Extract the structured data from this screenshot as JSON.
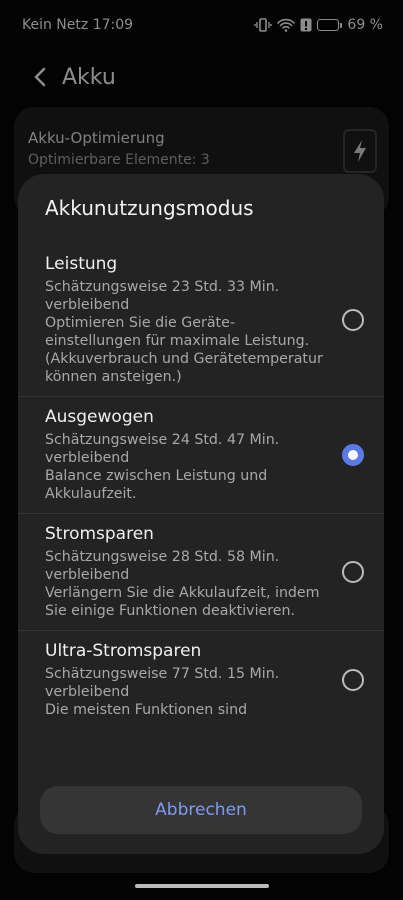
{
  "status_bar": {
    "carrier": "Kein Netz",
    "time": "17:09",
    "battery_percent": "69 %",
    "battery_level": 0.69
  },
  "app_bar": {
    "title": "Akku"
  },
  "background": {
    "card_title": "Akku-Optimierung",
    "card_subtitle": "Optimierbare Elemente: 3"
  },
  "dialog": {
    "title": "Akkunutzungsmodus",
    "options": [
      {
        "title": "Leistung",
        "estimate": "Schätzungsweise 23 Std. 33 Min. verbleibend",
        "description": "Optimieren Sie die Geräte-einstellungen für maximale Leistung. (Akkuverbrauch und Gerätetemperatur können ansteigen.)",
        "selected": false
      },
      {
        "title": "Ausgewogen",
        "estimate": "Schätzungsweise 24 Std. 47 Min. verbleibend",
        "description": "Balance zwischen Leistung und Akkulaufzeit.",
        "selected": true
      },
      {
        "title": "Stromsparen",
        "estimate": "Schätzungsweise 28 Std. 58 Min. verbleibend",
        "description": "Verlängern Sie die Akkulaufzeit, indem Sie einige Funktionen deaktivieren.",
        "selected": false
      },
      {
        "title": "Ultra-Stromsparen",
        "estimate": "Schätzungsweise 77 Std. 15 Min. verbleibend",
        "description": "Die meisten Funktionen sind",
        "selected": false
      }
    ],
    "cancel_label": "Abbrechen"
  },
  "colors": {
    "accent": "#5b7ae8",
    "cancel_text": "#7f9bf0",
    "dialog_bg": "#232323"
  }
}
